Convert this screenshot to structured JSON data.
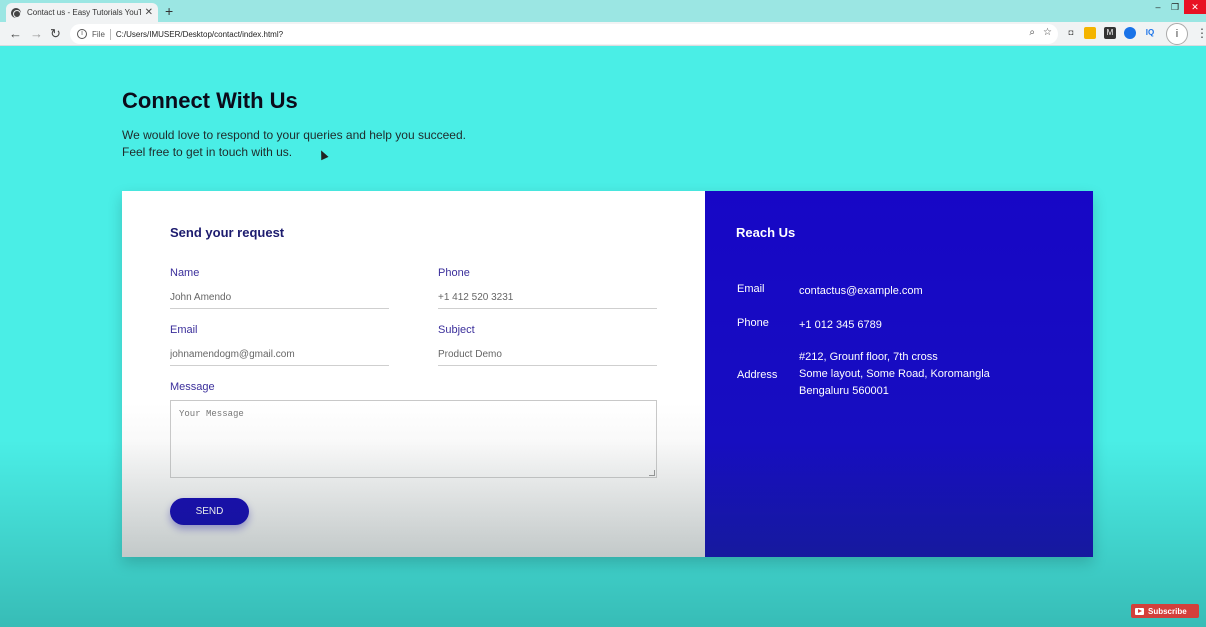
{
  "browser": {
    "tab_title": "Contact us - Easy Tutorials YouTu",
    "tab_close": "✕",
    "new_tab": "+",
    "url_scheme": "File",
    "url": "C:/Users/IMUSER/Desktop/contact/index.html?",
    "window_controls": {
      "minimize": "–",
      "maximize": "❐",
      "close": "✕"
    },
    "extension_iq": "IQ"
  },
  "page": {
    "heading": "Connect With Us",
    "intro_line1": "We would love to respond to your queries and help you succeed.",
    "intro_line2": "Feel free to get in touch with us."
  },
  "form": {
    "title": "Send your request",
    "name_label": "Name",
    "name_placeholder": "John Amendo",
    "phone_label": "Phone",
    "phone_placeholder": "+1 412 520 3231",
    "email_label": "Email",
    "email_placeholder": "johnamendogm@gmail.com",
    "subject_label": "Subject",
    "subject_placeholder": "Product Demo",
    "message_label": "Message",
    "message_placeholder": "Your Message",
    "send_label": "SEND"
  },
  "reach": {
    "title": "Reach Us",
    "email_key": "Email",
    "email_value": "contactus@example.com",
    "phone_key": "Phone",
    "phone_value": "+1 012 345 6789",
    "address_key": "Address",
    "address_line1": "#212, Grounf floor, 7th cross",
    "address_line2": "Some layout, Some Road, Koromangla",
    "address_line3": "Bengaluru 560001"
  },
  "overlay": {
    "subscribe": "Subscribe"
  },
  "colors": {
    "page_bg": "#4aeee6",
    "info_panel": "#1707c6",
    "send_button": "#1a0fb2",
    "label_text": "#3b2f9b"
  }
}
